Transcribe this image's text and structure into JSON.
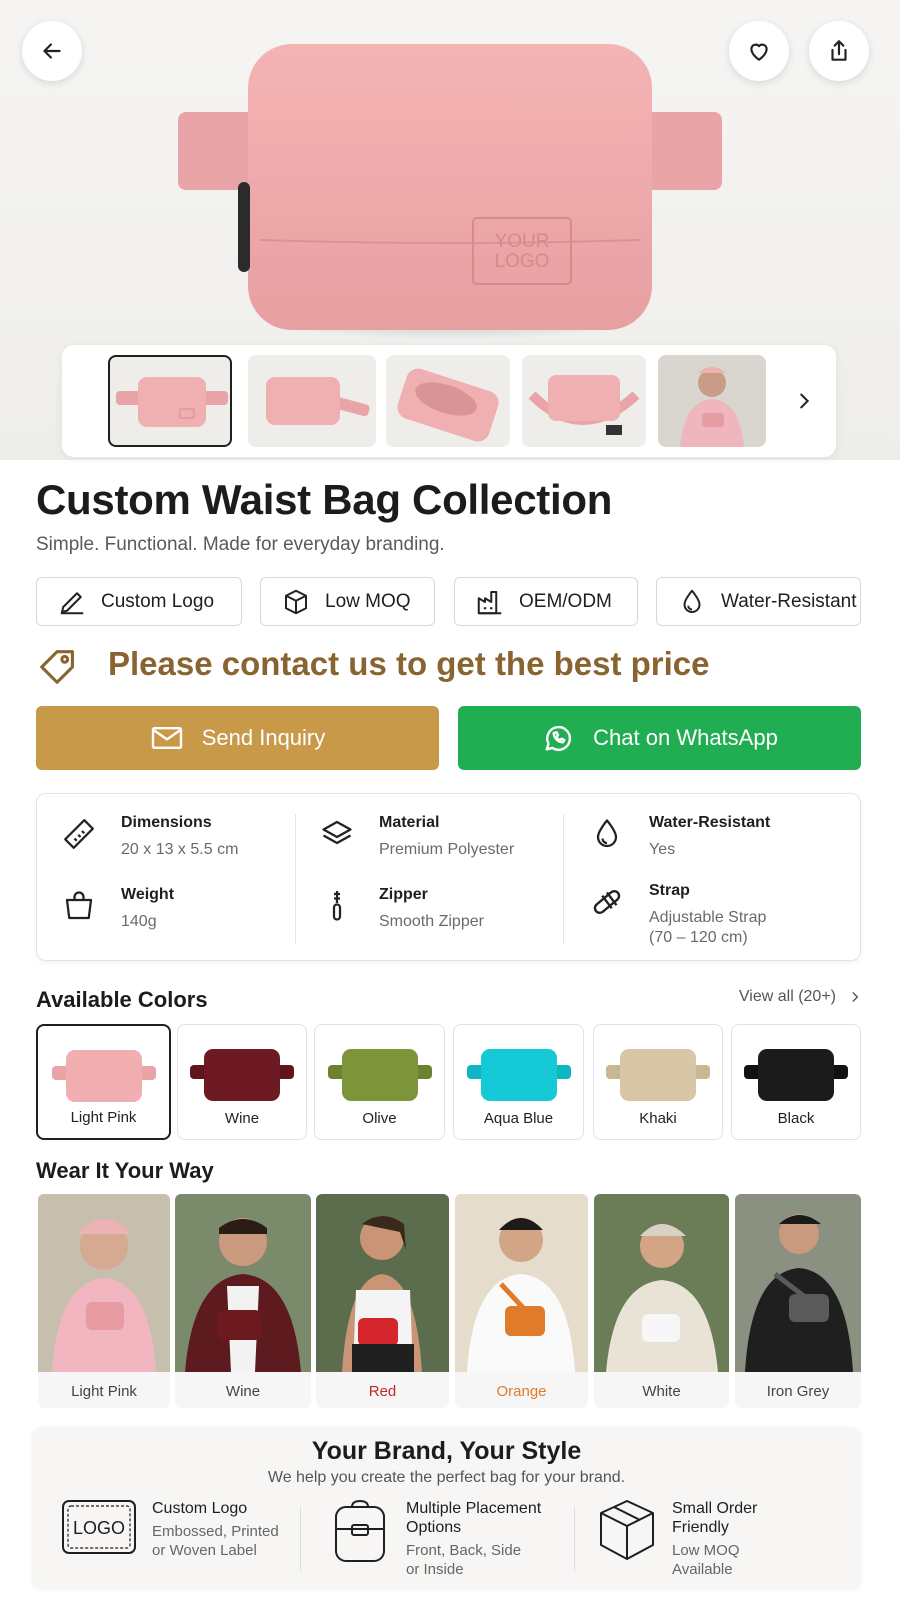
{
  "hero": {
    "logo_line1": "YOUR",
    "logo_line2": "LOGO"
  },
  "product": {
    "title": "Custom Waist Bag Collection",
    "subtitle": "Simple. Functional. Made for everyday branding."
  },
  "features": [
    {
      "label": "Custom Logo",
      "icon": "pencil-icon"
    },
    {
      "label": "Low MOQ",
      "icon": "box-icon"
    },
    {
      "label": "OEM/ODM",
      "icon": "factory-icon"
    },
    {
      "label": "Water-Resistant",
      "icon": "droplet-icon"
    }
  ],
  "price": {
    "text": "Please contact us to get the best price",
    "color": "#8a6430"
  },
  "cta": {
    "inquiry_label": "Send Inquiry",
    "whatsapp_label": "Chat on WhatsApp",
    "inquiry_color": "#c9994a",
    "whatsapp_color": "#21ad52"
  },
  "specs": [
    {
      "label": "Dimensions",
      "value": "20 x 13 x 5.5 cm",
      "icon": "ruler-icon"
    },
    {
      "label": "Weight",
      "value": "140g",
      "icon": "bag-icon"
    },
    {
      "label": "Material",
      "value": "Premium Polyester",
      "icon": "layers-icon"
    },
    {
      "label": "Zipper",
      "value": "Smooth Zipper",
      "icon": "zipper-icon"
    },
    {
      "label": "Water-Resistant",
      "value": "Yes",
      "icon": "droplet-icon"
    },
    {
      "label": "Strap",
      "value": "Adjustable Strap",
      "value2": "(70 – 120 cm)",
      "icon": "buckle-icon"
    }
  ],
  "colors": {
    "title": "Available Colors",
    "view_all": "View all (20+)",
    "items": [
      {
        "name": "Light Pink",
        "hex": "#f0aeb0"
      },
      {
        "name": "Wine",
        "hex": "#6e1a22"
      },
      {
        "name": "Olive",
        "hex": "#7e9438"
      },
      {
        "name": "Aqua Blue",
        "hex": "#16c9d6"
      },
      {
        "name": "Khaki",
        "hex": "#d8c6a6"
      },
      {
        "name": "Black",
        "hex": "#1b1b1b"
      }
    ]
  },
  "wear": {
    "title": "Wear It Your Way",
    "items": [
      {
        "name": "Light Pink",
        "color": "#444444"
      },
      {
        "name": "Wine",
        "color": "#444444"
      },
      {
        "name": "Red",
        "color": "#c0282d"
      },
      {
        "name": "Orange",
        "color": "#e07b2a"
      },
      {
        "name": "White",
        "color": "#444444"
      },
      {
        "name": "Iron Grey",
        "color": "#444444"
      }
    ]
  },
  "brand": {
    "title": "Your Brand, Your Style",
    "subtitle": "We help you create the perfect bag for your brand.",
    "logo_text": "LOGO",
    "items": [
      {
        "title": "Custom Logo",
        "desc1": "Embossed, Printed",
        "desc2": "or Woven Label"
      },
      {
        "title1": "Multiple Placement",
        "title2": "Options",
        "desc1": "Front, Back, Side",
        "desc2": "or Inside"
      },
      {
        "title1": "Small Order",
        "title2": "Friendly",
        "desc1": "Low MOQ",
        "desc2": "Available"
      }
    ]
  }
}
